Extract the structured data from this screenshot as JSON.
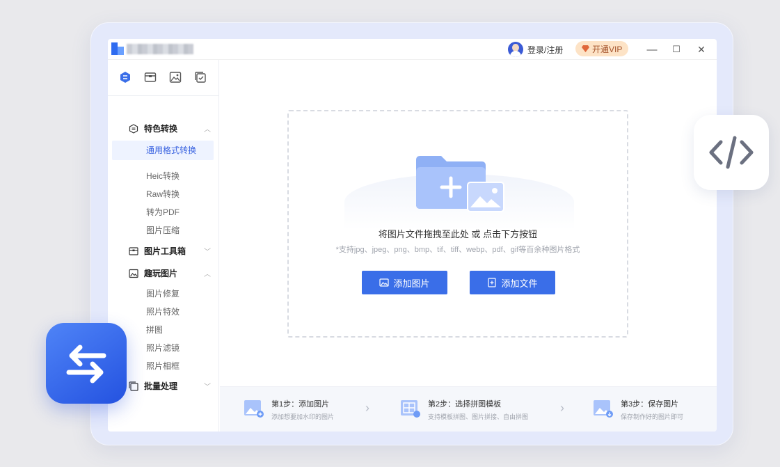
{
  "titlebar": {
    "login_label": "登录/注册",
    "vip_label": "开通VIP",
    "minimize": "—",
    "maximize": "☐",
    "close": "✕"
  },
  "sidebar": {
    "groups": [
      {
        "label": "特色转换",
        "icon": "convert-icon",
        "expanded": true,
        "items": [
          "通用格式转换",
          "Heic转换",
          "Raw转换",
          "转为PDF",
          "图片压缩"
        ]
      },
      {
        "label": "图片工具箱",
        "icon": "toolbox-icon",
        "expanded": false,
        "items": []
      },
      {
        "label": "趣玩图片",
        "icon": "image-play-icon",
        "expanded": true,
        "items": [
          "图片修复",
          "照片特效",
          "拼图",
          "照片滤镜",
          "照片相框"
        ]
      },
      {
        "label": "批量处理",
        "icon": "batch-icon",
        "expanded": false,
        "items": []
      }
    ],
    "active_item": "通用格式转换"
  },
  "main": {
    "drop_title": "将图片文件拖拽至此处 或 点击下方按钮",
    "drop_sub": "*支持jpg、jpeg、png、bmp、tif、tiff、webp、pdf、gif等百余种图片格式",
    "add_image_label": "添加图片",
    "add_file_label": "添加文件"
  },
  "steps": [
    {
      "title": "第1步：添加图片",
      "desc": "添加想要加水印的图片"
    },
    {
      "title": "第2步：选择拼图模板",
      "desc": "支持模板拼图、图片拼接、自由拼图"
    },
    {
      "title": "第3步：保存图片",
      "desc": "保存制作好的图片即可"
    }
  ],
  "colors": {
    "accent": "#3a6ee8",
    "vip_bg": "#fde3c6",
    "vip_text": "#a4522a"
  }
}
